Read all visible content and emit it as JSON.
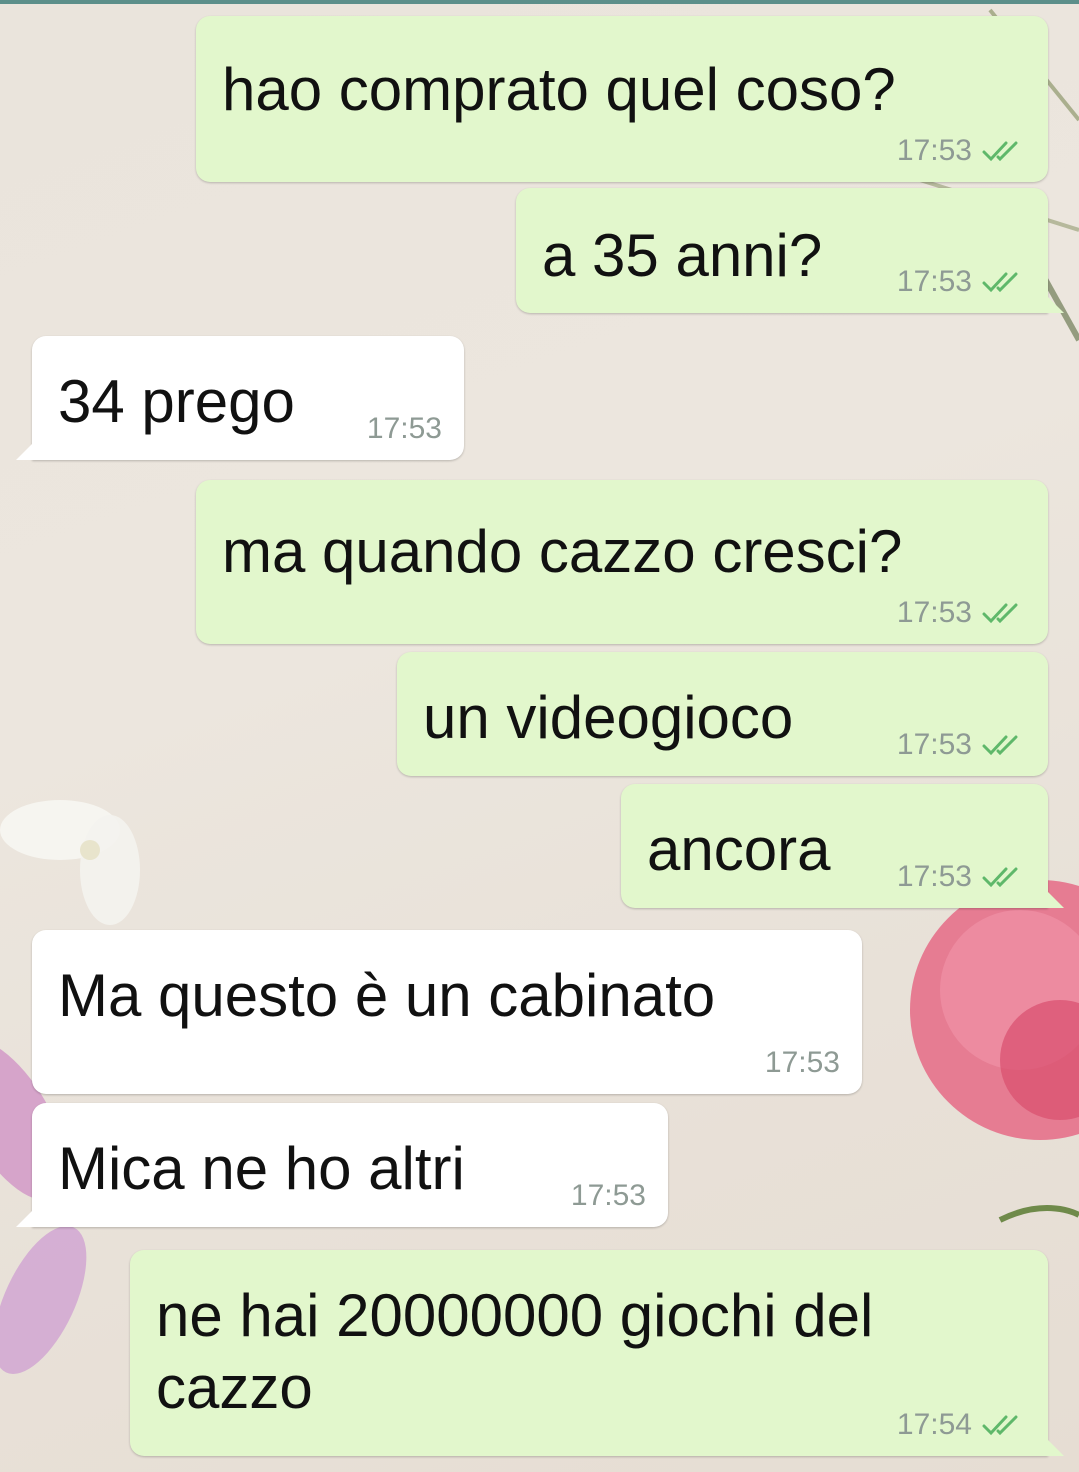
{
  "messages": [
    {
      "dir": "out",
      "text": "hao comprato quel coso?",
      "time": "17:53",
      "status": "double-check-icon"
    },
    {
      "dir": "out",
      "text": "a 35 anni?",
      "time": "17:53",
      "status": "double-check-icon"
    },
    {
      "dir": "in",
      "text": "34 prego",
      "time": "17:53"
    },
    {
      "dir": "out",
      "text": "ma quando cazzo cresci?",
      "time": "17:53",
      "status": "double-check-icon"
    },
    {
      "dir": "out",
      "text": "un videogioco",
      "time": "17:53",
      "status": "double-check-icon"
    },
    {
      "dir": "out",
      "text": "ancora",
      "time": "17:53",
      "status": "double-check-icon"
    },
    {
      "dir": "in",
      "text": "Ma questo è un cabinato",
      "time": "17:53"
    },
    {
      "dir": "in",
      "text": "Mica ne ho altri",
      "time": "17:53"
    },
    {
      "dir": "out",
      "text": "ne hai 20000000 giochi del cazzo",
      "time": "17:54",
      "status": "double-check-icon"
    }
  ],
  "colors": {
    "outgoing_bubble": "#e2f7cc",
    "incoming_bubble": "#ffffff",
    "tick": "#5fb86a",
    "time": "#8e9a94"
  }
}
